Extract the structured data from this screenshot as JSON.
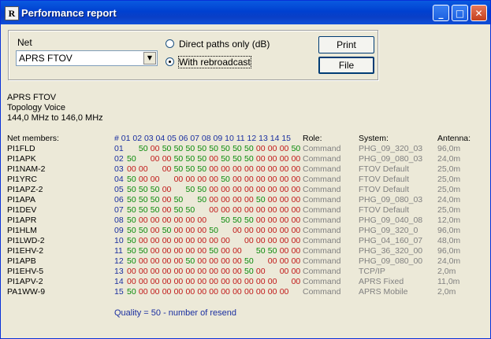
{
  "window": {
    "title": "Performance report",
    "icon": "app-icon"
  },
  "controls": {
    "net_label": "Net",
    "net_value": "APRS FTOV",
    "radio_direct": "Direct paths only (dB)",
    "radio_rebroadcast": "With rebroadcast",
    "radio_selected": "With rebroadcast",
    "print_label": "Print",
    "file_label": "File"
  },
  "info": {
    "net": "APRS FTOV",
    "topology": "Topology Voice",
    "frequency": "144,0 MHz to 146,0 MHz"
  },
  "headers": {
    "members": "Net members:",
    "numbers": "#  01 02 03 04 05 06 07 08 09 10 11 12 13 14 15",
    "role": "Role:",
    "system": "System:",
    "antenna": "Antenna:"
  },
  "members": [
    {
      "name": "PI1FLD",
      "num": "01",
      "cells": [
        "",
        "50",
        "00",
        "50",
        "50",
        "50",
        "50",
        "50",
        "50",
        "50",
        "50",
        "00",
        "00",
        "00",
        "50"
      ],
      "role": "Command",
      "system": "PHG_09_320_03",
      "antenna": "96,0m"
    },
    {
      "name": "PI1APK",
      "num": "02",
      "cells": [
        "50",
        "",
        "00",
        "00",
        "50",
        "50",
        "50",
        "00",
        "50",
        "50",
        "50",
        "00",
        "00",
        "00",
        "00"
      ],
      "role": "Command",
      "system": "PHG_09_080_03",
      "antenna": "24,0m"
    },
    {
      "name": "PI1NAM-2",
      "num": "03",
      "cells": [
        "00",
        "00",
        "",
        "00",
        "50",
        "50",
        "50",
        "00",
        "00",
        "00",
        "00",
        "00",
        "00",
        "00",
        "00"
      ],
      "role": "Command",
      "system": "FTOV Default",
      "antenna": "25,0m"
    },
    {
      "name": "PI1YRC",
      "num": "04",
      "cells": [
        "50",
        "00",
        "00",
        "",
        "00",
        "00",
        "00",
        "00",
        "50",
        "00",
        "00",
        "00",
        "00",
        "00",
        "00"
      ],
      "role": "Command",
      "system": "FTOV Default",
      "antenna": "25,0m"
    },
    {
      "name": "PI1APZ-2",
      "num": "05",
      "cells": [
        "50",
        "50",
        "50",
        "00",
        "",
        "50",
        "50",
        "00",
        "00",
        "00",
        "00",
        "00",
        "00",
        "00",
        "00"
      ],
      "role": "Command",
      "system": "FTOV Default",
      "antenna": "25,0m"
    },
    {
      "name": "PI1APA",
      "num": "06",
      "cells": [
        "50",
        "50",
        "50",
        "00",
        "50",
        "",
        "50",
        "00",
        "00",
        "00",
        "00",
        "50",
        "00",
        "00",
        "00"
      ],
      "role": "Command",
      "system": "PHG_09_080_03",
      "antenna": "24,0m"
    },
    {
      "name": "PI1DEV",
      "num": "07",
      "cells": [
        "50",
        "50",
        "50",
        "00",
        "50",
        "50",
        "",
        "00",
        "00",
        "00",
        "00",
        "00",
        "00",
        "00",
        "00"
      ],
      "role": "Command",
      "system": "FTOV Default",
      "antenna": "25,0m"
    },
    {
      "name": "PI1APR",
      "num": "08",
      "cells": [
        "50",
        "00",
        "00",
        "00",
        "00",
        "00",
        "00",
        "",
        "50",
        "50",
        "50",
        "00",
        "00",
        "00",
        "00"
      ],
      "role": "Command",
      "system": "PHG_09_040_08",
      "antenna": "12,0m"
    },
    {
      "name": "PI1HLM",
      "num": "09",
      "cells": [
        "50",
        "50",
        "00",
        "50",
        "00",
        "00",
        "00",
        "50",
        "",
        "00",
        "00",
        "00",
        "00",
        "00",
        "00"
      ],
      "role": "Command",
      "system": "PHG_09_320_0",
      "antenna": "96,0m"
    },
    {
      "name": "PI1LWD-2",
      "num": "10",
      "cells": [
        "50",
        "00",
        "00",
        "00",
        "00",
        "00",
        "00",
        "00",
        "00",
        "",
        "00",
        "00",
        "00",
        "00",
        "00"
      ],
      "role": "Command",
      "system": "PHG_04_160_07",
      "antenna": "48,0m"
    },
    {
      "name": "PI1EHV-2",
      "num": "11",
      "cells": [
        "50",
        "50",
        "00",
        "00",
        "00",
        "00",
        "00",
        "50",
        "00",
        "00",
        "",
        "50",
        "50",
        "00",
        "00"
      ],
      "role": "Command",
      "system": "PHG_36_320_00",
      "antenna": "96,0m"
    },
    {
      "name": "PI1APB",
      "num": "12",
      "cells": [
        "50",
        "00",
        "00",
        "00",
        "00",
        "50",
        "00",
        "00",
        "00",
        "00",
        "50",
        "",
        "00",
        "00",
        "00"
      ],
      "role": "Command",
      "system": "PHG_09_080_00",
      "antenna": "24,0m"
    },
    {
      "name": "PI1EHV-5",
      "num": "13",
      "cells": [
        "00",
        "00",
        "00",
        "00",
        "00",
        "00",
        "00",
        "00",
        "00",
        "00",
        "50",
        "00",
        "",
        "00",
        "00"
      ],
      "role": "Command",
      "system": "TCP/IP",
      "antenna": "2,0m"
    },
    {
      "name": "PI1APV-2",
      "num": "14",
      "cells": [
        "00",
        "00",
        "00",
        "00",
        "00",
        "00",
        "00",
        "00",
        "00",
        "00",
        "00",
        "00",
        "00",
        "",
        "00"
      ],
      "role": "Command",
      "system": "APRS Fixed",
      "antenna": "11,0m"
    },
    {
      "name": "PA1WW-9",
      "num": "15",
      "cells": [
        "50",
        "00",
        "00",
        "00",
        "00",
        "00",
        "00",
        "00",
        "00",
        "00",
        "00",
        "00",
        "00",
        "00",
        ""
      ],
      "role": "Command",
      "system": "APRS Mobile",
      "antenna": "2,0m"
    }
  ],
  "footer": {
    "quality": "Quality = 50 - number of resend"
  },
  "colors": {
    "good": "#0a8a0a",
    "bad": "#c01818",
    "number": "#1a2fa0",
    "muted": "#808080"
  }
}
